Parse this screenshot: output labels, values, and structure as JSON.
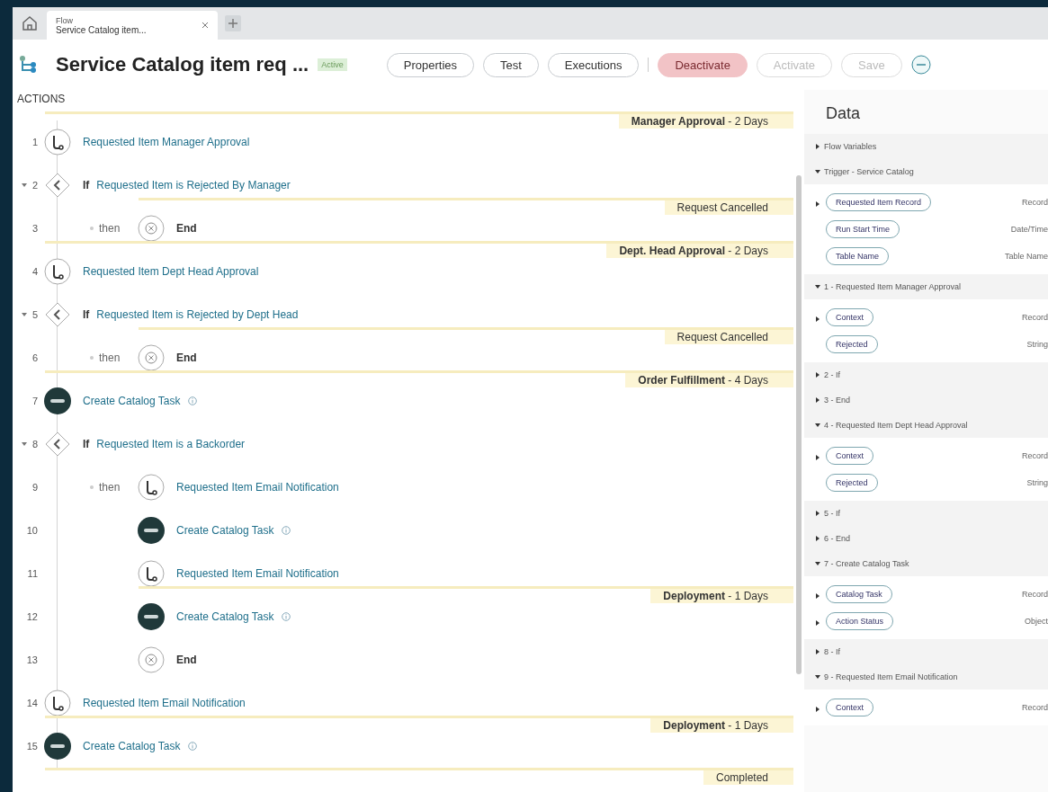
{
  "tabbar": {
    "tab": {
      "app": "Flow",
      "title": "Service Catalog item..."
    }
  },
  "header": {
    "title": "Service Catalog item req ...",
    "status": "Active",
    "buttons": [
      {
        "label": "Properties",
        "kind": "normal",
        "disabled": false
      },
      {
        "label": "Test",
        "kind": "normal",
        "disabled": false
      },
      {
        "label": "Executions",
        "kind": "normal",
        "disabled": false
      },
      {
        "label": "Deactivate",
        "kind": "danger",
        "disabled": false
      },
      {
        "label": "Activate",
        "kind": "normal",
        "disabled": true
      },
      {
        "label": "Save",
        "kind": "normal",
        "disabled": true
      }
    ]
  },
  "actions": {
    "heading": "ACTIONS",
    "rows": [
      {
        "number": "1",
        "kind": "action",
        "label": "Requested Item Manager Approval",
        "stage": "**Manager Approval** - 2 Days"
      },
      {
        "number": "2",
        "kind": "if",
        "prefix": "If",
        "label": "Requested Item is Rejected By Manager",
        "expanded": true,
        "children": [
          {
            "number": "3",
            "kind": "end",
            "connector": "then",
            "label": "End",
            "stage": "Request Cancelled"
          }
        ]
      },
      {
        "number": "4",
        "kind": "action",
        "label": "Requested Item Dept Head Approval",
        "stage": "**Dept. Head Approval** - 2 Days"
      },
      {
        "number": "5",
        "kind": "if",
        "prefix": "If",
        "label": "Requested Item is Rejected by Dept Head",
        "expanded": true,
        "children": [
          {
            "number": "6",
            "kind": "end",
            "connector": "then",
            "label": "End",
            "stage": "Request Cancelled"
          }
        ]
      },
      {
        "number": "7",
        "kind": "task",
        "label": "Create Catalog Task",
        "stage": "**Order Fulfillment** - 4 Days"
      },
      {
        "number": "8",
        "kind": "if",
        "prefix": "If",
        "label": "Requested Item is a Backorder",
        "expanded": true,
        "children": [
          {
            "number": "9",
            "kind": "action",
            "connector": "then",
            "label": "Requested Item Email Notification"
          },
          {
            "number": "10",
            "kind": "task",
            "label": "Create Catalog Task"
          },
          {
            "number": "11",
            "kind": "action",
            "label": "Requested Item Email Notification"
          },
          {
            "number": "12",
            "kind": "task",
            "label": "Create Catalog Task",
            "stage": "**Deployment** - 1 Days"
          },
          {
            "number": "13",
            "kind": "end",
            "label": "End"
          }
        ]
      },
      {
        "number": "14",
        "kind": "action",
        "label": "Requested Item Email Notification"
      },
      {
        "number": "15",
        "kind": "task",
        "label": "Create Catalog Task",
        "stage": "**Deployment** - 1 Days"
      }
    ],
    "trailing_stage": "Completed"
  },
  "data_panel": {
    "title": "Data",
    "sections": [
      {
        "title": "Flow Variables",
        "expanded": false
      },
      {
        "title": "Trigger - Service Catalog",
        "expanded": true,
        "items": [
          {
            "label": "Requested Item Record",
            "type": "Record",
            "expandable": true
          },
          {
            "label": "Run Start Time",
            "type": "Date/Time",
            "expandable": false
          },
          {
            "label": "Table Name",
            "type": "Table Name",
            "expandable": false
          }
        ]
      },
      {
        "title": "1 - Requested Item Manager Approval",
        "expanded": true,
        "items": [
          {
            "label": "Context",
            "type": "Record",
            "expandable": true
          },
          {
            "label": "Rejected",
            "type": "String",
            "expandable": false
          }
        ]
      },
      {
        "title": "2 - If",
        "expanded": false
      },
      {
        "title": "3 - End",
        "expanded": false
      },
      {
        "title": "4 - Requested Item Dept Head Approval",
        "expanded": true,
        "items": [
          {
            "label": "Context",
            "type": "Record",
            "expandable": true
          },
          {
            "label": "Rejected",
            "type": "String",
            "expandable": false
          }
        ]
      },
      {
        "title": "5 - If",
        "expanded": false
      },
      {
        "title": "6 - End",
        "expanded": false
      },
      {
        "title": "7 - Create Catalog Task",
        "expanded": true,
        "items": [
          {
            "label": "Catalog Task",
            "type": "Record",
            "expandable": true
          },
          {
            "label": "Action Status",
            "type": "Object",
            "expandable": true
          }
        ]
      },
      {
        "title": "8 - If",
        "expanded": false
      },
      {
        "title": "9 - Requested Item Email Notification",
        "expanded": true,
        "items": [
          {
            "label": "Context",
            "type": "Record",
            "expandable": true
          }
        ]
      }
    ]
  }
}
